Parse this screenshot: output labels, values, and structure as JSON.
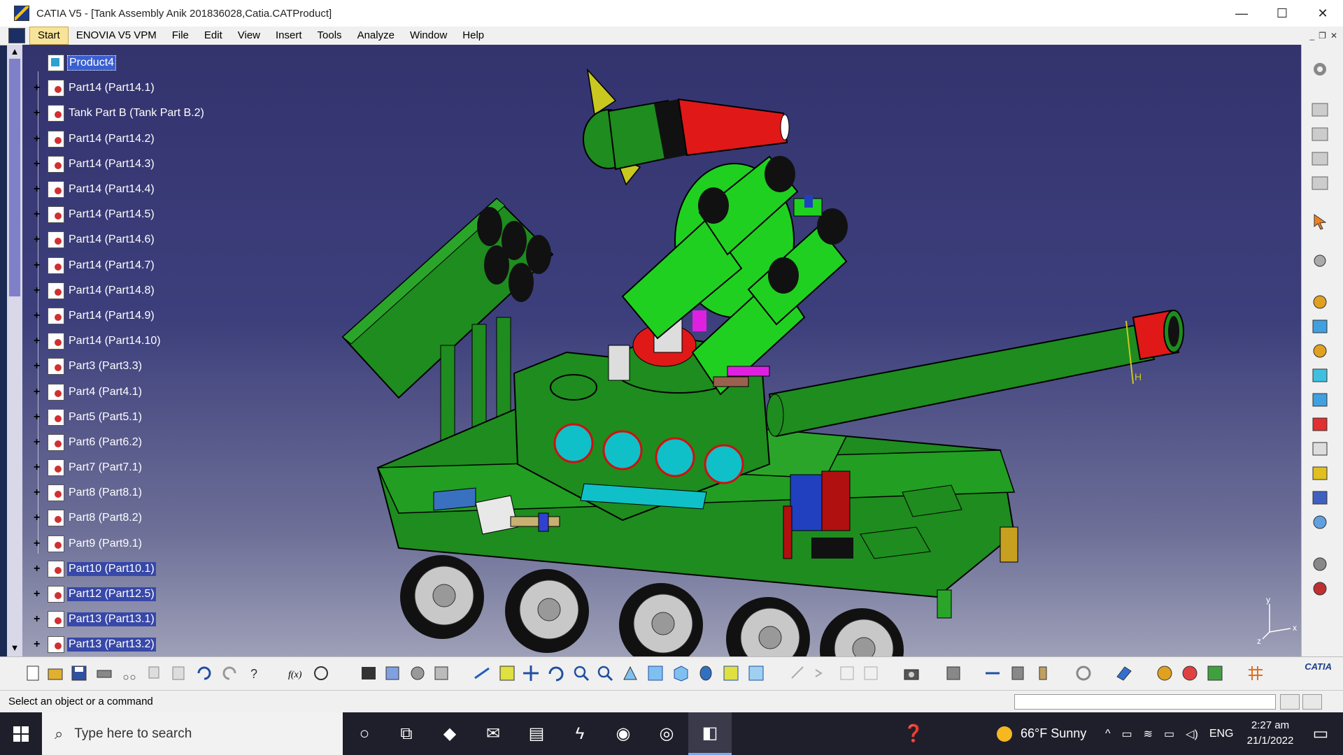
{
  "window": {
    "title": "CATIA V5 - [Tank Assembly Anik 201836028,Catia.CATProduct]",
    "minimize": "—",
    "maximize": "☐",
    "close": "✕"
  },
  "menu": {
    "items": [
      "Start",
      "ENOVIA V5 VPM",
      "File",
      "Edit",
      "View",
      "Insert",
      "Tools",
      "Analyze",
      "Window",
      "Help"
    ],
    "mdi_minimize": "_",
    "mdi_restore": "❐",
    "mdi_close": "✕"
  },
  "tree": {
    "root": "Product4",
    "items": [
      "Part14 (Part14.1)",
      "Tank Part B (Tank Part B.2)",
      "Part14 (Part14.2)",
      "Part14 (Part14.3)",
      "Part14 (Part14.4)",
      "Part14 (Part14.5)",
      "Part14 (Part14.6)",
      "Part14 (Part14.7)",
      "Part14 (Part14.8)",
      "Part14 (Part14.9)",
      "Part14 (Part14.10)",
      "Part3 (Part3.3)",
      "Part4 (Part4.1)",
      "Part5 (Part5.1)",
      "Part6 (Part6.2)",
      "Part7 (Part7.1)",
      "Part8 (Part8.1)",
      "Part8 (Part8.2)",
      "Part9 (Part9.1)",
      "Part10 (Part10.1)",
      "Part12 (Part12.5)",
      "Part13 (Part13.1)",
      "Part13 (Part13.2)"
    ],
    "selected_from_index": 19
  },
  "axis": {
    "y": "y",
    "x": "x",
    "z": "z",
    "h": "H",
    "v": "V"
  },
  "status": {
    "text": "Select an object or a command"
  },
  "taskbar": {
    "search_placeholder": "Type here to search",
    "weather": "66°F  Sunny",
    "language": "ENG",
    "time": "2:27 am",
    "date": "21/1/2022"
  },
  "colors": {
    "tank_green": "#1e8c1e",
    "accent_red": "#e01818",
    "cyan": "#10c0c8",
    "viewport_top": "#33336e"
  }
}
